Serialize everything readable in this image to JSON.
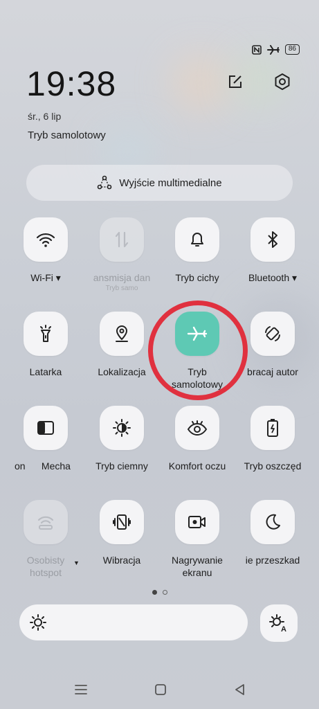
{
  "status_bar": {
    "nfc_icon": "nfc-icon",
    "airplane_icon": "airplane-icon",
    "battery": "86"
  },
  "header": {
    "time": "19:38",
    "date": "śr., 6 lip",
    "mode": "Tryb samolotowy",
    "edit_icon": "edit-icon",
    "settings_icon": "gear-icon"
  },
  "media_output": {
    "label": "Wyjście multimedialne",
    "icon": "media-output-icon"
  },
  "tiles": [
    {
      "label": "Wi-Fi ▾",
      "icon": "wifi-icon",
      "state": "off"
    },
    {
      "label": "ansmisja dan",
      "sub": "Tryb samo",
      "icon": "mobile-data-icon",
      "state": "disabled"
    },
    {
      "label": "Tryb cichy",
      "icon": "bell-icon",
      "state": "off"
    },
    {
      "label": "Bluetooth ▾",
      "icon": "bluetooth-icon",
      "state": "off"
    },
    {
      "label": "Latarka",
      "icon": "flashlight-icon",
      "state": "off"
    },
    {
      "label": "Lokalizacja",
      "icon": "location-icon",
      "state": "off"
    },
    {
      "label": "Tryb samolotowy",
      "label_line1": "Tryb",
      "label_line2": "samolotowy",
      "icon": "airplane-icon",
      "state": "on"
    },
    {
      "label": "bracaj autor",
      "icon": "auto-rotate-icon",
      "state": "off"
    },
    {
      "label": "on      Mecha",
      "icon": "split-screen-icon",
      "state": "off"
    },
    {
      "label": "Tryb ciemny",
      "icon": "dark-mode-icon",
      "state": "off"
    },
    {
      "label": "Komfort oczu",
      "icon": "eye-icon",
      "state": "off"
    },
    {
      "label": "Tryb oszczęd",
      "icon": "battery-saver-icon",
      "state": "off"
    },
    {
      "label": "Osobisty hotspot",
      "label_line1": "Osobisty",
      "label_line2": "hotspot",
      "icon": "hotspot-icon",
      "state": "disabled"
    },
    {
      "label": "Wibracja",
      "icon": "vibration-icon",
      "state": "off"
    },
    {
      "label": "Nagrywanie ekranu",
      "label_line1": "Nagrywanie",
      "label_line2": "ekranu",
      "icon": "screen-record-icon",
      "state": "off"
    },
    {
      "label": "ie przeszkad",
      "icon": "moon-icon",
      "state": "off"
    }
  ],
  "page_indicator": {
    "current": 1,
    "total": 2
  },
  "brightness": {
    "icon": "sun-icon",
    "auto_icon": "auto-brightness-icon"
  },
  "nav_bar": {
    "menu": "menu-icon",
    "home": "home-icon",
    "back": "back-icon"
  },
  "colors": {
    "accent_on": "#5ec9b4",
    "highlight_ring": "#e0313f",
    "tile_bg": "#f4f4f6"
  }
}
